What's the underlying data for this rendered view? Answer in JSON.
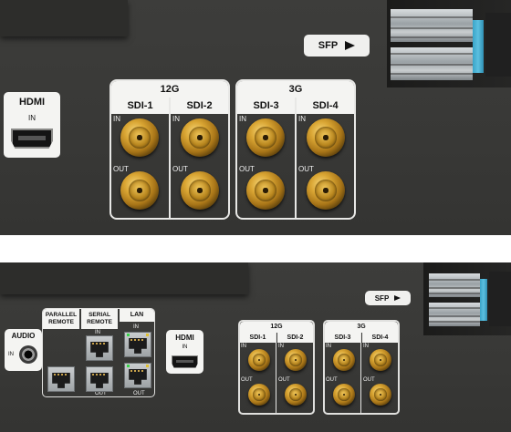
{
  "top_panel": {
    "sfp_label": "SFP",
    "hdmi": {
      "title": "HDMI",
      "sub": "IN"
    },
    "group_12g": {
      "title": "12G",
      "sdi": [
        "SDI-1",
        "SDI-2"
      ]
    },
    "group_3g": {
      "title": "3G",
      "sdi": [
        "SDI-3",
        "SDI-4"
      ]
    },
    "in_label": "IN",
    "out_label": "OUT"
  },
  "bottom_panel": {
    "sfp_label": "SFP",
    "audio": {
      "title": "AUDIO",
      "sub": "IN"
    },
    "parallel_remote": "PARALLEL REMOTE",
    "serial_remote": "SERIAL REMOTE",
    "lan": "LAN",
    "rj_in": "IN",
    "rj_out": "OUT",
    "hdmi": {
      "title": "HDMI",
      "sub": "IN"
    },
    "group_12g": {
      "title": "12G",
      "sdi": [
        "SDI-1",
        "SDI-2"
      ]
    },
    "group_3g": {
      "title": "3G",
      "sdi": [
        "SDI-3",
        "SDI-4"
      ]
    },
    "in_label": "IN",
    "out_label": "OUT"
  },
  "colors": {
    "panel": "#3a3a38",
    "label_plate": "#f4f4f2",
    "bnc_gold": "#d9a533",
    "sfp_blue": "#3aa4c8"
  }
}
